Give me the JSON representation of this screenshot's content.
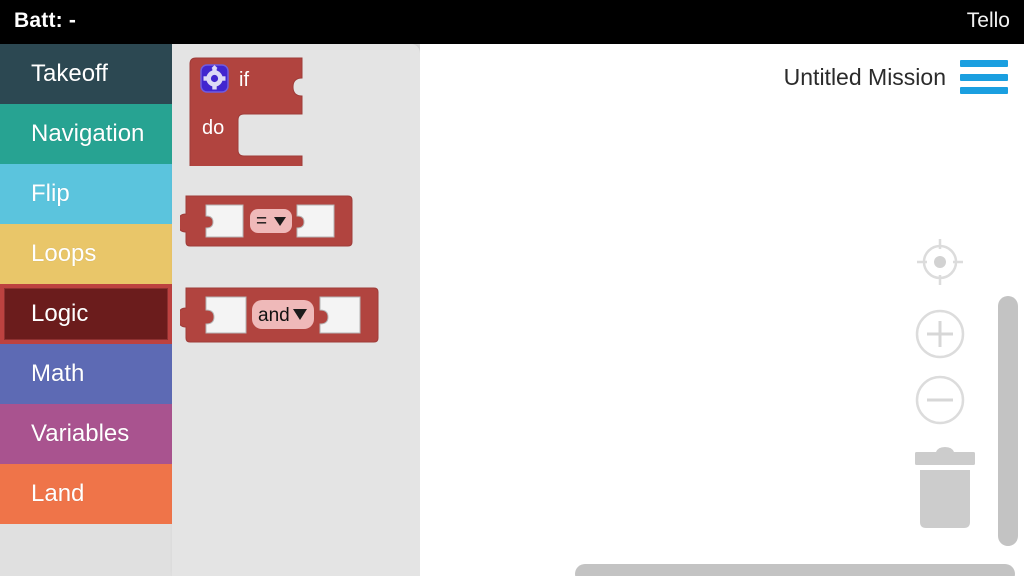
{
  "statusbar": {
    "battery_label": "Batt: -",
    "device_name": "Tello"
  },
  "sidebar": {
    "items": [
      {
        "label": "Takeoff",
        "color": "#2c4852",
        "selected": false
      },
      {
        "label": "Navigation",
        "color": "#27a392",
        "selected": false
      },
      {
        "label": "Flip",
        "color": "#5bc4dd",
        "selected": false
      },
      {
        "label": "Loops",
        "color": "#e9c669",
        "selected": false
      },
      {
        "label": "Logic",
        "color": "#bd4240",
        "selected": true
      },
      {
        "label": "Math",
        "color": "#5d6ab4",
        "selected": false
      },
      {
        "label": "Variables",
        "color": "#a9538f",
        "selected": false
      },
      {
        "label": "Land",
        "color": "#ef7449",
        "selected": false
      }
    ]
  },
  "flyout": {
    "category": "Logic",
    "blocks": [
      {
        "name": "if-do-block",
        "if_label": "if",
        "do_label": "do",
        "icon": "gear-icon"
      },
      {
        "name": "compare-block",
        "operator": "=",
        "dropdown": "▼"
      },
      {
        "name": "logic-and-block",
        "operator": "and",
        "dropdown": "▼"
      }
    ]
  },
  "canvas": {
    "mission_title": "Untitled Mission",
    "menu_icon": "hamburger-icon",
    "controls": [
      {
        "name": "center-target-icon",
        "label": "center"
      },
      {
        "name": "zoom-in-icon",
        "label": "+"
      },
      {
        "name": "zoom-out-icon",
        "label": "−"
      },
      {
        "name": "trash-icon",
        "label": "delete"
      }
    ]
  },
  "colors": {
    "block_red": "#b1443f",
    "block_field_pink": "#efb9b9",
    "gear_blue": "#4126cf",
    "accent_blue": "#1a9fe0",
    "scrollbar": "#c3c3c3"
  }
}
